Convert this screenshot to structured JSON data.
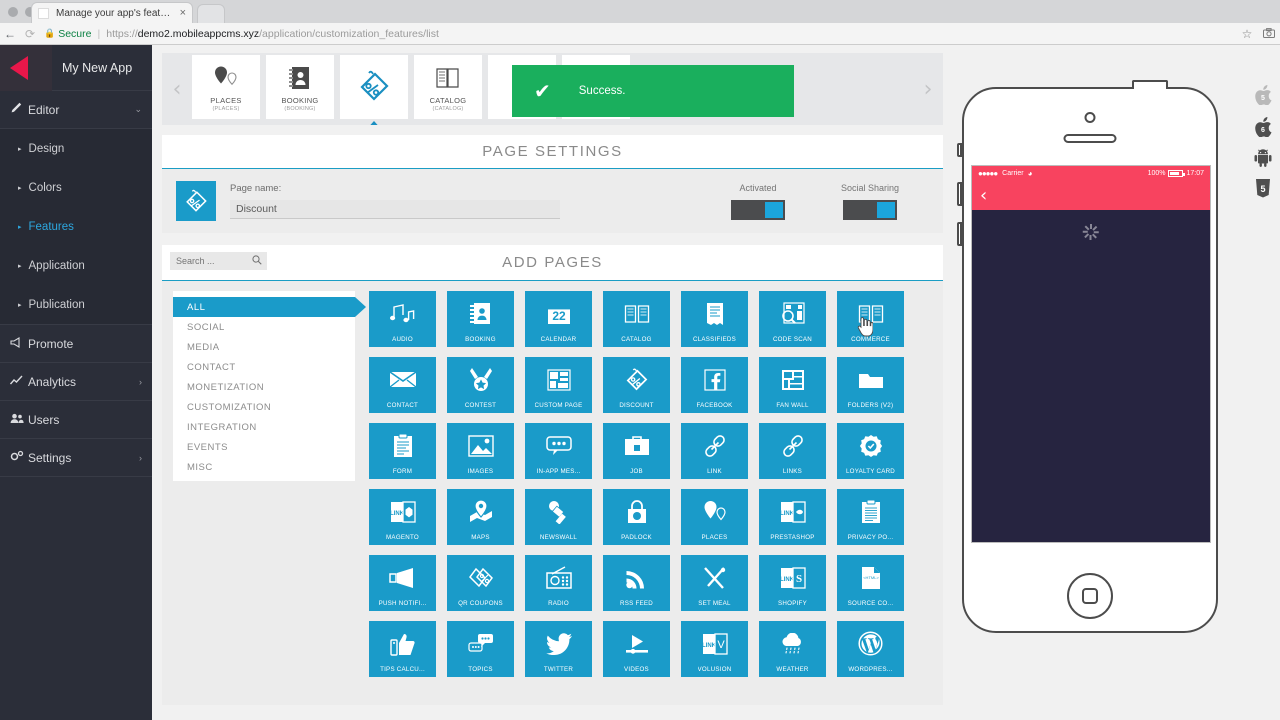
{
  "browser": {
    "tab_title": "Manage your app's features",
    "tab_close": "×",
    "back_arrow": "←",
    "forward_arrow": "→",
    "reload_icon": "⟳",
    "lock_icon": "🔒",
    "secure_label": "Secure",
    "url_separator": "|",
    "url_scheme": "https://",
    "url_host": "demo2.mobileappcms.xyz",
    "url_path": "/application/customization_features/list",
    "star_icon": "☆",
    "camera_icon": "◉"
  },
  "sidebar": {
    "brand": "My New App",
    "editor": {
      "label": "Editor",
      "icon": "pencil-icon",
      "caret": "⌄"
    },
    "editor_items": [
      {
        "label": "Design",
        "selected": false
      },
      {
        "label": "Colors",
        "selected": false
      },
      {
        "label": "Features",
        "selected": true
      },
      {
        "label": "Application",
        "selected": false
      },
      {
        "label": "Publication",
        "selected": false
      }
    ],
    "sections": [
      {
        "label": "Promote",
        "icon": "megaphone-icon",
        "caret": ""
      },
      {
        "label": "Analytics",
        "icon": "chart-icon",
        "caret": "›"
      },
      {
        "label": "Users",
        "icon": "users-icon",
        "caret": ""
      },
      {
        "label": "Settings",
        "icon": "gears-icon",
        "caret": "›"
      }
    ],
    "sub_arrow": "▸"
  },
  "carousel": {
    "prev": "‹",
    "next": "›",
    "move_icon": "◂▸",
    "delete_icon": "✖",
    "items": [
      {
        "name": "PLACES",
        "sub": "(PLACES)",
        "icon": "places-icon",
        "active": false
      },
      {
        "name": "BOOKING",
        "sub": "(BOOKING)",
        "icon": "booking-icon",
        "active": false
      },
      {
        "name": "",
        "sub": "",
        "icon": "discount-icon",
        "active": true
      },
      {
        "name": "CATALOG",
        "sub": "(CATALOG)",
        "icon": "catalog-icon",
        "active": false
      },
      {
        "name": "",
        "sub": "",
        "icon": "blank-icon",
        "active": false
      },
      {
        "name": "",
        "sub": "",
        "icon": "blank-icon",
        "active": false
      }
    ]
  },
  "toast": {
    "icon": "check-icon",
    "message": "Success."
  },
  "page_settings": {
    "title": "PAGE SETTINGS",
    "icon": "discount-icon",
    "page_name_label": "Page name:",
    "page_name_value": "Discount",
    "page_name_placeholder": "Page name",
    "toggles": [
      {
        "label": "Activated",
        "on": true
      },
      {
        "label": "Social Sharing",
        "on": true
      }
    ]
  },
  "add_pages": {
    "title": "ADD PAGES",
    "search_placeholder": "Search ...",
    "search_value": "",
    "search_icon": "search-icon",
    "categories": [
      {
        "label": "ALL",
        "selected": true
      },
      {
        "label": "SOCIAL",
        "selected": false
      },
      {
        "label": "MEDIA",
        "selected": false
      },
      {
        "label": "CONTACT",
        "selected": false
      },
      {
        "label": "MONETIZATION",
        "selected": false
      },
      {
        "label": "CUSTOMIZATION",
        "selected": false
      },
      {
        "label": "INTEGRATION",
        "selected": false
      },
      {
        "label": "EVENTS",
        "selected": false
      },
      {
        "label": "MISC",
        "selected": false
      }
    ],
    "tiles": [
      {
        "label": "AUDIO",
        "icon": "music-note-icon"
      },
      {
        "label": "BOOKING",
        "icon": "address-book-icon"
      },
      {
        "label": "CALENDAR",
        "icon": "calendar-22-icon",
        "badge": "22"
      },
      {
        "label": "CATALOG",
        "icon": "open-book-icon"
      },
      {
        "label": "CLASSIFIEDS",
        "icon": "document-list-icon"
      },
      {
        "label": "CODE SCAN",
        "icon": "magnifier-grid-icon"
      },
      {
        "label": "COMMERCE",
        "icon": "open-book-icon"
      },
      {
        "label": "CONTACT",
        "icon": "envelope-icon"
      },
      {
        "label": "CONTEST",
        "icon": "medal-star-icon"
      },
      {
        "label": "CUSTOM PAGE",
        "icon": "layout-blocks-icon"
      },
      {
        "label": "DISCOUNT",
        "icon": "discount-tag-icon"
      },
      {
        "label": "FACEBOOK",
        "icon": "facebook-icon"
      },
      {
        "label": "FAN WALL",
        "icon": "fanwall-icon"
      },
      {
        "label": "FOLDERS (V2)",
        "icon": "folder-icon"
      },
      {
        "label": "FORM",
        "icon": "clipboard-lines-icon"
      },
      {
        "label": "IMAGES",
        "icon": "picture-icon"
      },
      {
        "label": "IN-APP MES...",
        "icon": "chat-bubble-icon"
      },
      {
        "label": "JOB",
        "icon": "briefcase-icon"
      },
      {
        "label": "LINK",
        "icon": "chain-link-icon"
      },
      {
        "label": "LINKS",
        "icon": "chain-link-icon"
      },
      {
        "label": "LOYALTY CARD",
        "icon": "badge-check-icon"
      },
      {
        "label": "MAGENTO",
        "icon": "link-door-icon"
      },
      {
        "label": "MAPS",
        "icon": "map-pin-icon"
      },
      {
        "label": "NEWSWALL",
        "icon": "microphone-news-icon"
      },
      {
        "label": "PADLOCK",
        "icon": "padlock-icon"
      },
      {
        "label": "PLACES",
        "icon": "places-pin-icon"
      },
      {
        "label": "PRESTASHOP",
        "icon": "link-door-icon"
      },
      {
        "label": "PRIVACY PO...",
        "icon": "clipboard-lines-icon"
      },
      {
        "label": "PUSH NOTIFI...",
        "icon": "push-megaphone-icon"
      },
      {
        "label": "QR COUPONS",
        "icon": "discount-tag-icon"
      },
      {
        "label": "RADIO",
        "icon": "radio-icon"
      },
      {
        "label": "RSS FEED",
        "icon": "rss-icon"
      },
      {
        "label": "SET MEAL",
        "icon": "fork-knife-icon"
      },
      {
        "label": "SHOPIFY",
        "icon": "link-door-icon"
      },
      {
        "label": "SOURCE CO...",
        "icon": "html-file-icon"
      },
      {
        "label": "TIPS CALCU...",
        "icon": "thumbs-up-icon"
      },
      {
        "label": "TOPICS",
        "icon": "chat-bubbles-icon"
      },
      {
        "label": "TWITTER",
        "icon": "twitter-icon"
      },
      {
        "label": "VIDEOS",
        "icon": "play-video-icon"
      },
      {
        "label": "VOLUSION",
        "icon": "link-door-icon"
      },
      {
        "label": "WEATHER",
        "icon": "cloud-rain-icon"
      },
      {
        "label": "WORDPRES...",
        "icon": "wordpress-icon"
      }
    ]
  },
  "preview": {
    "status": {
      "signal_dots": "●●●●●",
      "carrier": "Carrier",
      "wifi_icon": "wifi-icon",
      "battery_percent": "100%",
      "time": "17:07"
    },
    "back_icon": "‹",
    "loading": "spinner-icon",
    "home_icon": "home-button-icon"
  },
  "os_icons": [
    {
      "name": "apple-5-icon",
      "label": "5"
    },
    {
      "name": "apple-6-icon",
      "label": "6"
    },
    {
      "name": "android-icon",
      "label": ""
    },
    {
      "name": "html5-icon",
      "label": "5"
    }
  ],
  "colors": {
    "accent": "#1a9bc9",
    "sidebar": "#2b2e39",
    "brand_red": "#e8174a",
    "success": "#1aaf5d",
    "phone_bar": "#f8435f",
    "phone_body": "#262440"
  }
}
